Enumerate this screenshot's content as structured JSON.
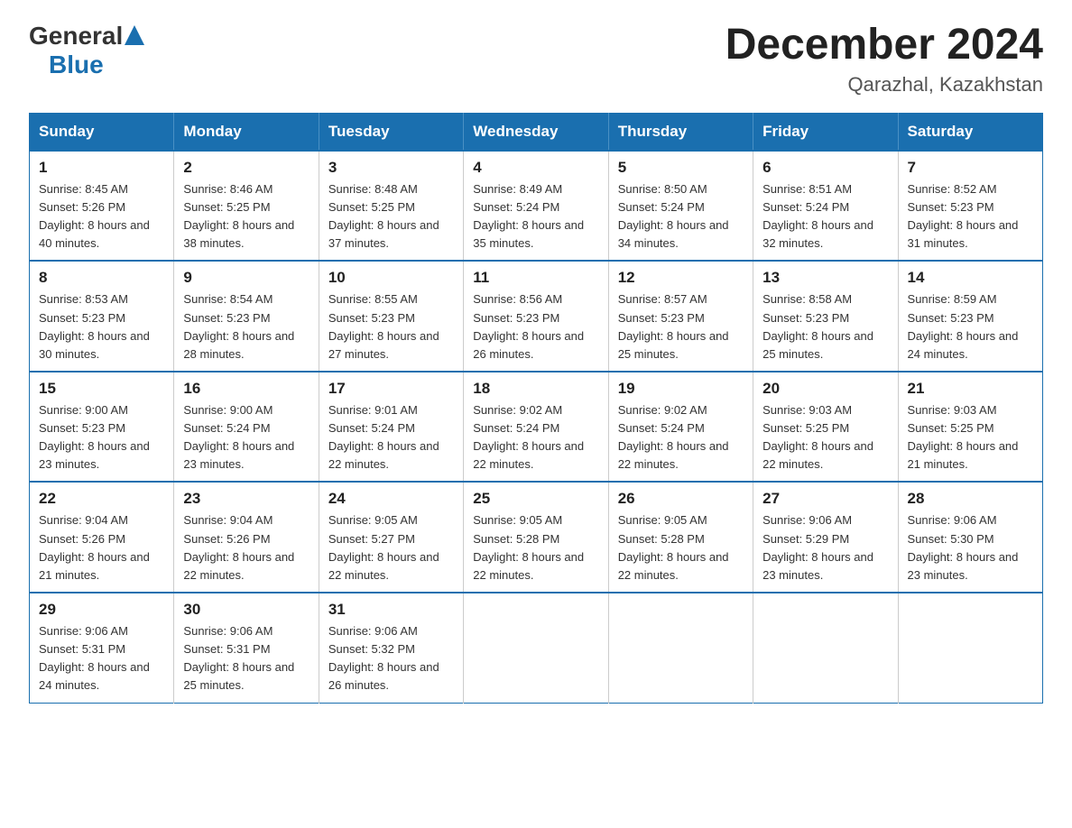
{
  "logo": {
    "text_general": "General",
    "text_blue": "Blue"
  },
  "title": "December 2024",
  "subtitle": "Qarazhal, Kazakhstan",
  "days_header": [
    "Sunday",
    "Monday",
    "Tuesday",
    "Wednesday",
    "Thursday",
    "Friday",
    "Saturday"
  ],
  "weeks": [
    [
      {
        "day": "1",
        "sunrise": "8:45 AM",
        "sunset": "5:26 PM",
        "daylight": "8 hours and 40 minutes."
      },
      {
        "day": "2",
        "sunrise": "8:46 AM",
        "sunset": "5:25 PM",
        "daylight": "8 hours and 38 minutes."
      },
      {
        "day": "3",
        "sunrise": "8:48 AM",
        "sunset": "5:25 PM",
        "daylight": "8 hours and 37 minutes."
      },
      {
        "day": "4",
        "sunrise": "8:49 AM",
        "sunset": "5:24 PM",
        "daylight": "8 hours and 35 minutes."
      },
      {
        "day": "5",
        "sunrise": "8:50 AM",
        "sunset": "5:24 PM",
        "daylight": "8 hours and 34 minutes."
      },
      {
        "day": "6",
        "sunrise": "8:51 AM",
        "sunset": "5:24 PM",
        "daylight": "8 hours and 32 minutes."
      },
      {
        "day": "7",
        "sunrise": "8:52 AM",
        "sunset": "5:23 PM",
        "daylight": "8 hours and 31 minutes."
      }
    ],
    [
      {
        "day": "8",
        "sunrise": "8:53 AM",
        "sunset": "5:23 PM",
        "daylight": "8 hours and 30 minutes."
      },
      {
        "day": "9",
        "sunrise": "8:54 AM",
        "sunset": "5:23 PM",
        "daylight": "8 hours and 28 minutes."
      },
      {
        "day": "10",
        "sunrise": "8:55 AM",
        "sunset": "5:23 PM",
        "daylight": "8 hours and 27 minutes."
      },
      {
        "day": "11",
        "sunrise": "8:56 AM",
        "sunset": "5:23 PM",
        "daylight": "8 hours and 26 minutes."
      },
      {
        "day": "12",
        "sunrise": "8:57 AM",
        "sunset": "5:23 PM",
        "daylight": "8 hours and 25 minutes."
      },
      {
        "day": "13",
        "sunrise": "8:58 AM",
        "sunset": "5:23 PM",
        "daylight": "8 hours and 25 minutes."
      },
      {
        "day": "14",
        "sunrise": "8:59 AM",
        "sunset": "5:23 PM",
        "daylight": "8 hours and 24 minutes."
      }
    ],
    [
      {
        "day": "15",
        "sunrise": "9:00 AM",
        "sunset": "5:23 PM",
        "daylight": "8 hours and 23 minutes."
      },
      {
        "day": "16",
        "sunrise": "9:00 AM",
        "sunset": "5:24 PM",
        "daylight": "8 hours and 23 minutes."
      },
      {
        "day": "17",
        "sunrise": "9:01 AM",
        "sunset": "5:24 PM",
        "daylight": "8 hours and 22 minutes."
      },
      {
        "day": "18",
        "sunrise": "9:02 AM",
        "sunset": "5:24 PM",
        "daylight": "8 hours and 22 minutes."
      },
      {
        "day": "19",
        "sunrise": "9:02 AM",
        "sunset": "5:24 PM",
        "daylight": "8 hours and 22 minutes."
      },
      {
        "day": "20",
        "sunrise": "9:03 AM",
        "sunset": "5:25 PM",
        "daylight": "8 hours and 22 minutes."
      },
      {
        "day": "21",
        "sunrise": "9:03 AM",
        "sunset": "5:25 PM",
        "daylight": "8 hours and 21 minutes."
      }
    ],
    [
      {
        "day": "22",
        "sunrise": "9:04 AM",
        "sunset": "5:26 PM",
        "daylight": "8 hours and 21 minutes."
      },
      {
        "day": "23",
        "sunrise": "9:04 AM",
        "sunset": "5:26 PM",
        "daylight": "8 hours and 22 minutes."
      },
      {
        "day": "24",
        "sunrise": "9:05 AM",
        "sunset": "5:27 PM",
        "daylight": "8 hours and 22 minutes."
      },
      {
        "day": "25",
        "sunrise": "9:05 AM",
        "sunset": "5:28 PM",
        "daylight": "8 hours and 22 minutes."
      },
      {
        "day": "26",
        "sunrise": "9:05 AM",
        "sunset": "5:28 PM",
        "daylight": "8 hours and 22 minutes."
      },
      {
        "day": "27",
        "sunrise": "9:06 AM",
        "sunset": "5:29 PM",
        "daylight": "8 hours and 23 minutes."
      },
      {
        "day": "28",
        "sunrise": "9:06 AM",
        "sunset": "5:30 PM",
        "daylight": "8 hours and 23 minutes."
      }
    ],
    [
      {
        "day": "29",
        "sunrise": "9:06 AM",
        "sunset": "5:31 PM",
        "daylight": "8 hours and 24 minutes."
      },
      {
        "day": "30",
        "sunrise": "9:06 AM",
        "sunset": "5:31 PM",
        "daylight": "8 hours and 25 minutes."
      },
      {
        "day": "31",
        "sunrise": "9:06 AM",
        "sunset": "5:32 PM",
        "daylight": "8 hours and 26 minutes."
      },
      null,
      null,
      null,
      null
    ]
  ],
  "labels": {
    "sunrise_prefix": "Sunrise: ",
    "sunset_prefix": "Sunset: ",
    "daylight_prefix": "Daylight: "
  }
}
